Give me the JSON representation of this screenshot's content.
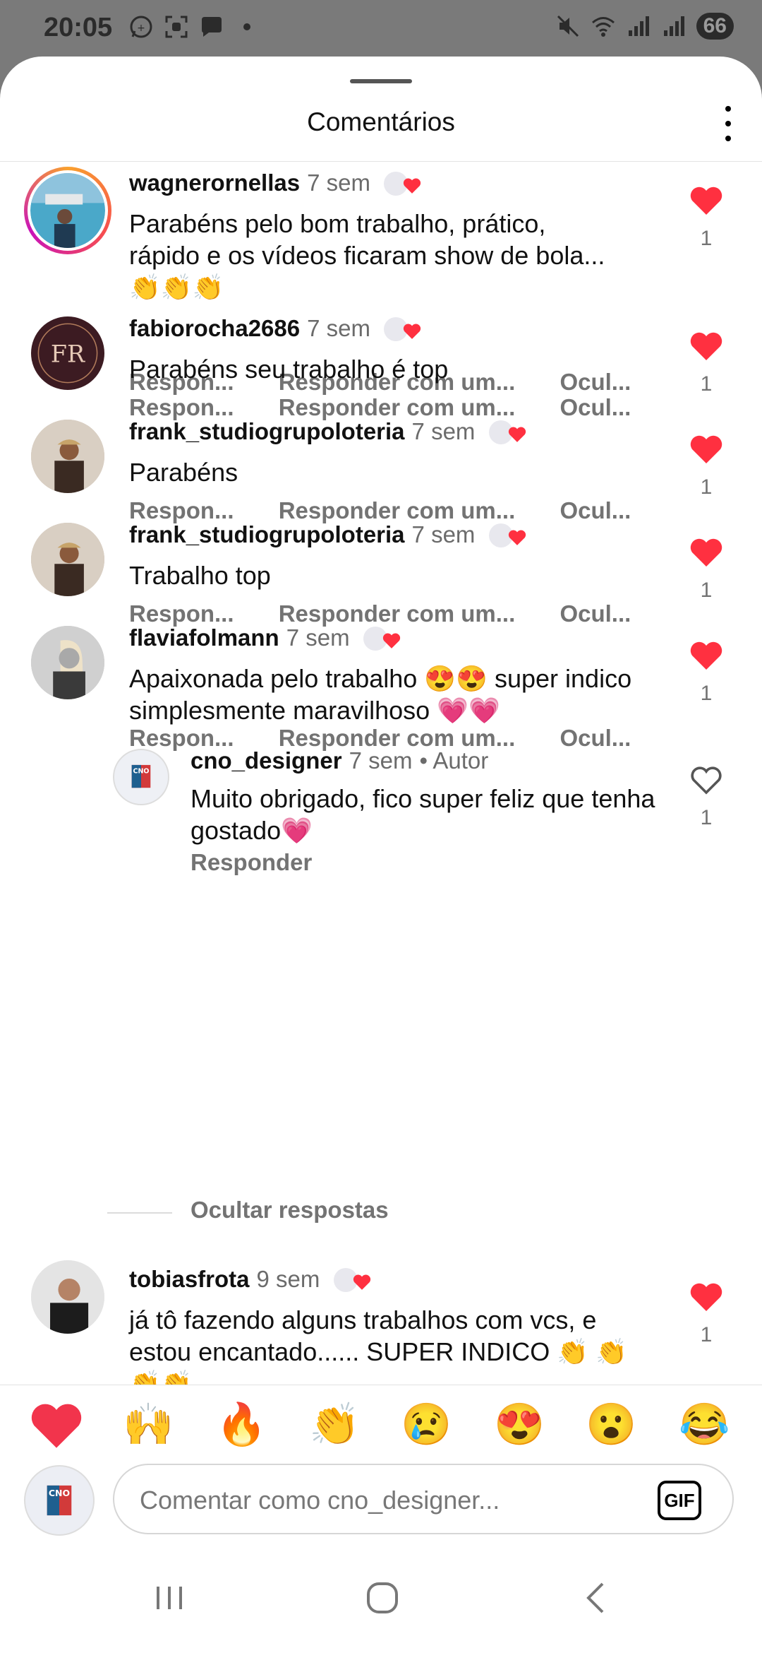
{
  "status_bar": {
    "time": "20:05",
    "battery": "66",
    "left_icons": [
      "whatsapp-icon",
      "screenshot-icon",
      "chat-icon",
      "dot-icon"
    ],
    "right_icons": [
      "mute-icon",
      "wifi-icon",
      "signal-icon",
      "signal-icon"
    ]
  },
  "header": {
    "title": "Comentários"
  },
  "actions_labels": {
    "reply": "Respon...",
    "reply_with": "Responder com um...",
    "hide": "Ocul...",
    "reply_full": "Responder"
  },
  "comments": [
    {
      "username": "wagnerornellas",
      "time": "7 sem",
      "text": "Parabéns pelo bom trabalho, prático, rápido e os vídeos ficaram show de bola...👏👏👏",
      "likes": "1"
    },
    {
      "username": "fabiorocha2686",
      "time": "7 sem",
      "text": "Parabéns seu trabalho é top",
      "likes": "1"
    },
    {
      "username": "frank_studiogrupoloteria",
      "time": "7 sem",
      "text": "Parabéns",
      "likes": "1"
    },
    {
      "username": "frank_studiogrupoloteria",
      "time": "7 sem",
      "text": "Trabalho top",
      "likes": "1"
    },
    {
      "username": "flaviafolmann",
      "time": "7 sem",
      "text": "Apaixonada pelo trabalho 😍😍 super indico simplesmente maravilhoso 💗💗",
      "likes": "1"
    }
  ],
  "reply": {
    "username": "cno_designer",
    "time": "7 sem",
    "author_tag": "• Autor",
    "text": "Muito obrigado,  fico super feliz que tenha gostado💗",
    "likes": "1"
  },
  "hide_replies": "Ocultar respostas",
  "last_comment": {
    "username": "tobiasfrota",
    "time": "9 sem",
    "text": "já tô fazendo alguns trabalhos com vcs, e estou encantado...... SUPER INDICO 👏 👏👏👏",
    "likes": "1"
  },
  "reactions": [
    "❤️",
    "🙌",
    "🔥",
    "👏",
    "😢",
    "😍",
    "😮",
    "😂"
  ],
  "composer": {
    "placeholder": "Comentar como cno_designer...",
    "gif_label": "GIF"
  },
  "colors": {
    "like_red": "#ff3040",
    "muted_text": "#737373",
    "story_ring_start": "#f9a12e",
    "story_ring_end": "#c913b9"
  }
}
